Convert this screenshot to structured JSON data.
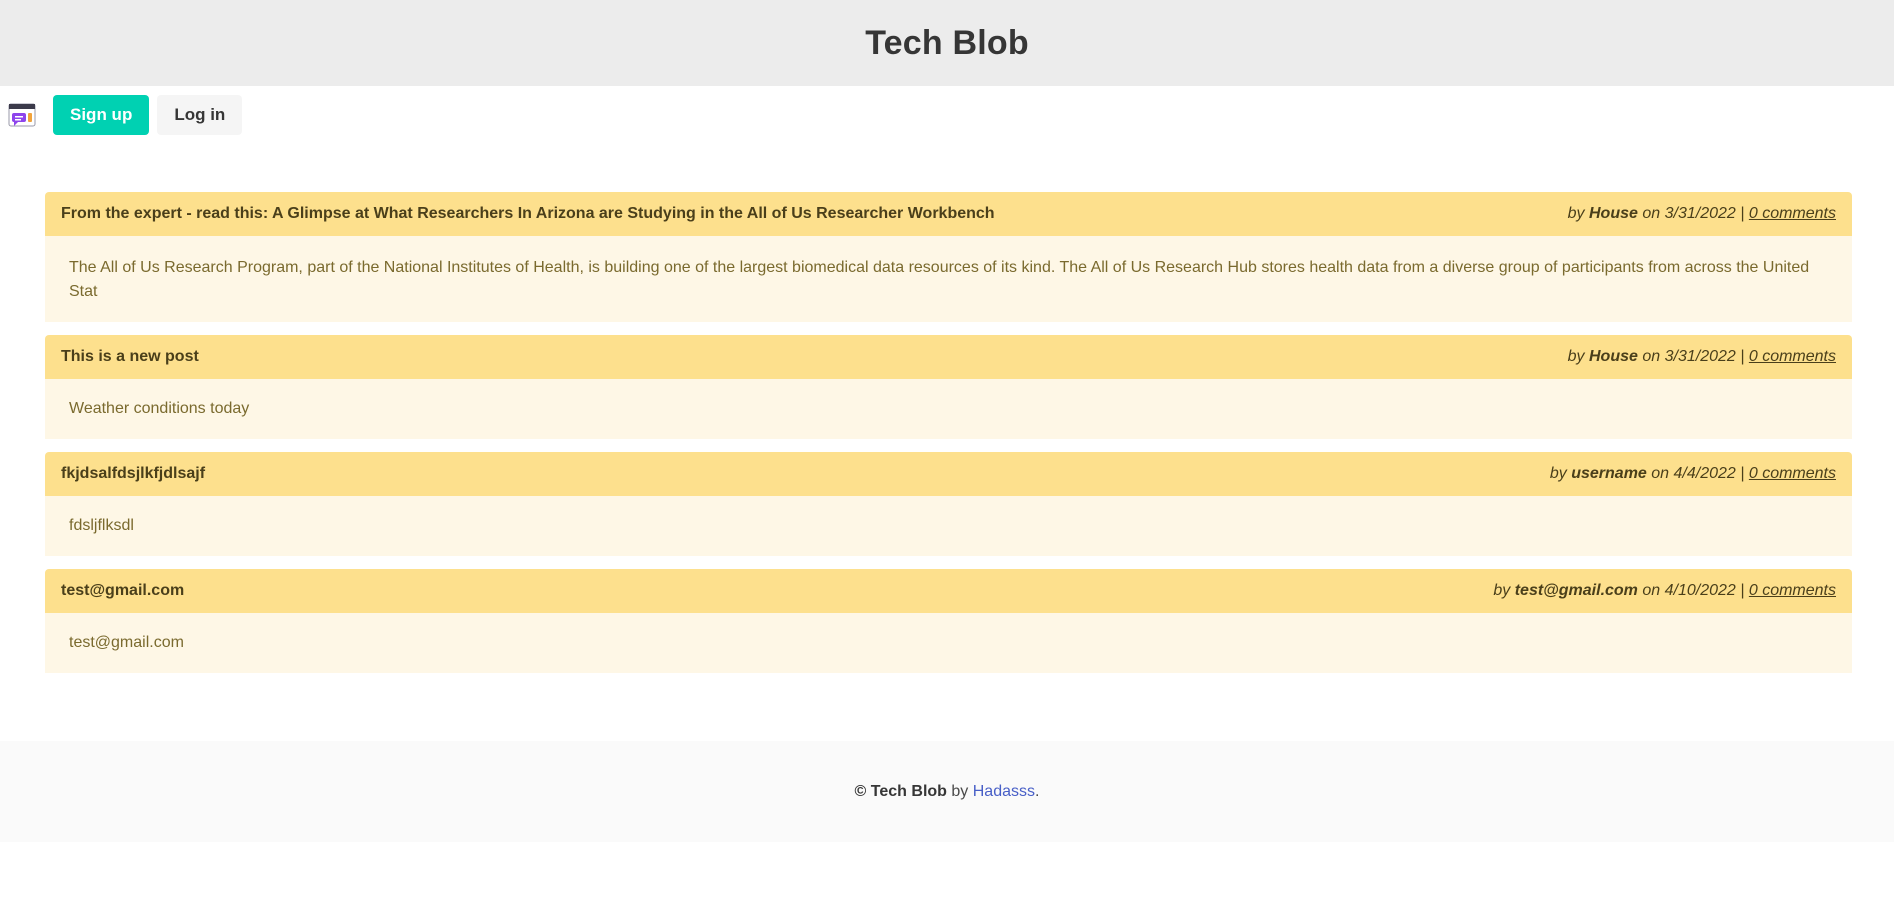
{
  "header": {
    "title": "Tech Blob"
  },
  "nav": {
    "logo_icon": "chat-window-icon",
    "signup_label": "Sign up",
    "login_label": "Log in"
  },
  "posts": [
    {
      "title": "From the expert - read this: A Glimpse at What Researchers In Arizona are Studying in the All of Us Researcher Workbench",
      "by": "by",
      "author": "House",
      "on": "on",
      "date": "3/31/2022",
      "sep": "|",
      "comments": "0 comments",
      "body": "The All of Us Research Program, part of the National Institutes of Health, is building one of the largest biomedical data resources of its kind. The All of Us Research Hub stores health data from a diverse group of participants from across the United Stat"
    },
    {
      "title": "This is a new post",
      "by": "by",
      "author": "House",
      "on": "on",
      "date": "3/31/2022",
      "sep": "|",
      "comments": "0 comments",
      "body": "Weather conditions today"
    },
    {
      "title": "fkjdsalfdsjlkfjdlsajf",
      "by": "by",
      "author": "username",
      "on": "on",
      "date": "4/4/2022",
      "sep": "|",
      "comments": "0 comments",
      "body": "fdsljflksdl"
    },
    {
      "title": "test@gmail.com",
      "by": "by",
      "author": "test@gmail.com",
      "on": "on",
      "date": "4/10/2022",
      "sep": "|",
      "comments": "0 comments",
      "body": "test@gmail.com"
    }
  ],
  "footer": {
    "copyright": "©",
    "brand": "Tech Blob",
    "by": "by",
    "author_link": "Hadasss",
    "period": "."
  },
  "colors": {
    "accent": "#00d1b2",
    "post_header": "#fde08d",
    "post_body": "#fef7e6",
    "link": "#485fc7"
  }
}
